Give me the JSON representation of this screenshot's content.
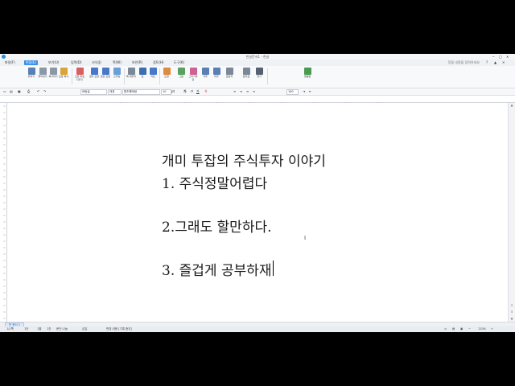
{
  "window": {
    "title": "한글문서1 - 한글"
  },
  "menu": {
    "items": [
      "파일(F)",
      "편집(E)",
      "보기(U)",
      "입력(D)",
      "서식(J)",
      "쪽(W)",
      "보안(R)",
      "검토(H)",
      "도구(K)"
    ],
    "active_index": 1,
    "help_placeholder": "찾을 내용을 입력하세요"
  },
  "ribbon": {
    "buttons": [
      {
        "label": "붙이기",
        "icon": "paste-icon",
        "color": "#5a7fb5"
      },
      {
        "label": "잘라내기",
        "icon": "cut-icon",
        "color": "#8c98a8"
      },
      {
        "label": "복사하기",
        "icon": "copy-icon",
        "color": "#8c98a8"
      },
      {
        "label": "모양 복사",
        "icon": "format-painter-icon",
        "color": "#d9a43a"
      },
      {
        "label": "조판 부호 지우기",
        "icon": "eraser-icon",
        "color": "#d96060"
      },
      {
        "label": "글자 모양",
        "icon": "char-shape-icon",
        "color": "#4a78c8"
      },
      {
        "label": "문단 모양",
        "icon": "para-shape-icon",
        "color": "#4a78c8"
      },
      {
        "label": "스타일",
        "icon": "style-icon",
        "color": "#6aa0d8"
      },
      {
        "label": "쪽 테두리",
        "icon": "page-border-icon",
        "color": "#7a8898"
      },
      {
        "label": "표",
        "icon": "table-icon",
        "color": "#3a6fb0"
      },
      {
        "label": "차트",
        "icon": "chart-icon",
        "color": "#4a78c8"
      },
      {
        "label": "도형",
        "icon": "shape-icon",
        "color": "#e08a40"
      },
      {
        "label": "그림",
        "icon": "picture-icon",
        "color": "#5aa060"
      },
      {
        "label": "그리기마당",
        "icon": "clipart-icon",
        "color": "#d06090"
      },
      {
        "label": "각주",
        "icon": "footnote-icon",
        "color": "#5a7fb5"
      },
      {
        "label": "미주",
        "icon": "endnote-icon",
        "color": "#5a7fb5"
      },
      {
        "label": "글상자",
        "icon": "textbox-icon",
        "color": "#7a8898"
      },
      {
        "label": "문자표",
        "icon": "symbol-icon",
        "color": "#7a8898"
      },
      {
        "label": "찾기",
        "icon": "binoculars-icon",
        "color": "#556070"
      },
      {
        "label": "맞춤법",
        "icon": "spellcheck-icon",
        "color": "#4a9a50"
      }
    ]
  },
  "format": {
    "style": "바탕글",
    "font_lang": "대표",
    "font": "함초롬바탕",
    "size": "10",
    "unit": "pt",
    "zoom": "160"
  },
  "document": {
    "lines": [
      "개미 투잡의 주식투자 이야기",
      "1. 주식정말어렵다",
      "",
      "2.그래도 할만하다.",
      "",
      "3. 즐겁게 공부하재"
    ]
  },
  "tabs": {
    "doc_tab": "빈 문서 1"
  },
  "status": {
    "page": "1/1쪽",
    "section": "1단",
    "line": "1줄",
    "col": "1칸",
    "chars": "문단 나눔",
    "mode": "삽입",
    "change": "변경 내용 [기록 중지]",
    "zoom": "120%"
  }
}
